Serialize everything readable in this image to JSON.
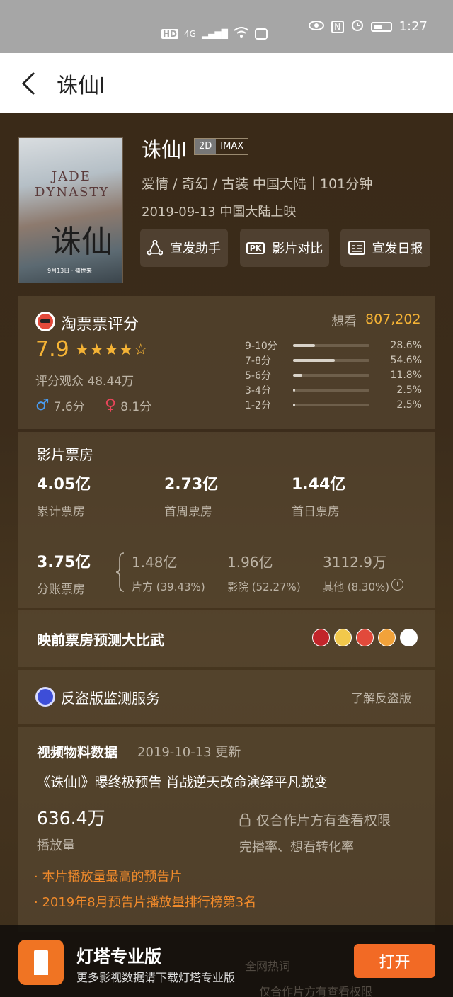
{
  "status_bar": {
    "left_icons": [
      "HD",
      "4G"
    ],
    "time": "1:27"
  },
  "nav": {
    "title": "诛仙Ⅰ"
  },
  "movie": {
    "poster_title": "JADE DYNASTY",
    "poster_char": "诛仙",
    "poster_date": "9月13日 · 盛世来",
    "name": "诛仙Ⅰ",
    "tags": [
      "2D",
      "IMAX"
    ],
    "genres_line": "爱情 / 奇幻 / 古装 中国大陆｜101分钟",
    "release_line": "2019-09-13 中国大陆上映",
    "actions": [
      {
        "label": "宣发助手",
        "icon": "share-network-icon"
      },
      {
        "label": "影片对比",
        "icon": "pk-icon"
      },
      {
        "label": "宣发日报",
        "icon": "report-icon"
      }
    ]
  },
  "rating": {
    "brand": "淘票票评分",
    "want_label": "想看",
    "want_count": "807,202",
    "score": "7.9",
    "stars": "★★★★☆",
    "audience": "评分观众 48.44万",
    "male_score": "7.6分",
    "female_score": "8.1分",
    "distribution": [
      {
        "label": "9-10分",
        "pct": "28.6%",
        "value": 28.6
      },
      {
        "label": "7-8分",
        "pct": "54.6%",
        "value": 54.6
      },
      {
        "label": "5-6分",
        "pct": "11.8%",
        "value": 11.8
      },
      {
        "label": "3-4分",
        "pct": "2.5%",
        "value": 2.5
      },
      {
        "label": "1-2分",
        "pct": "2.5%",
        "value": 2.5
      }
    ]
  },
  "box_office": {
    "title": "影片票房",
    "stats": [
      {
        "value": "4.05亿",
        "label": "累计票房"
      },
      {
        "value": "2.73亿",
        "label": "首周票房"
      },
      {
        "value": "1.44亿",
        "label": "首日票房"
      }
    ],
    "split_value": "3.75亿",
    "split_label": "分账票房",
    "split": [
      {
        "value": "1.48亿",
        "label": "片方 (39.43%)"
      },
      {
        "value": "1.96亿",
        "label": "影院 (52.27%)"
      },
      {
        "value": "3112.9万",
        "label": "其他 (8.30%)"
      }
    ]
  },
  "predict": {
    "title": "映前票房预测大比武",
    "avatar_colors": [
      "#c2252a",
      "#f2c84b",
      "#e24a3b",
      "#f2a23a",
      "#ffffff"
    ]
  },
  "anti_piracy": {
    "title": "反盗版监测服务",
    "link": "了解反盗版"
  },
  "video": {
    "title": "视频物料数据",
    "date": "2019-10-13 更新",
    "headline": "《诛仙Ⅰ》曝终极预告 肖战逆天改命演绎平凡蜕变",
    "views": "636.4万",
    "views_label": "播放量",
    "locked_text": "仅合作片方有查看权限",
    "locked_sub": "完播率、想看转化率",
    "highlights": [
      "· 本片播放量最高的预告片",
      "· 2019年8月预告片播放量排行榜第3名"
    ]
  },
  "bottom_bar": {
    "app_name": "灯塔专业版",
    "subtitle": "更多影视数据请下载灯塔专业版",
    "open_label": "打开",
    "behind_text_1": "全网热词",
    "behind_text_2": "仅合作片方有查看权限"
  },
  "colors": {
    "accent_orange": "#f26a25",
    "score_gold": "#f5b335",
    "highlight_orange": "#f08a2b"
  }
}
